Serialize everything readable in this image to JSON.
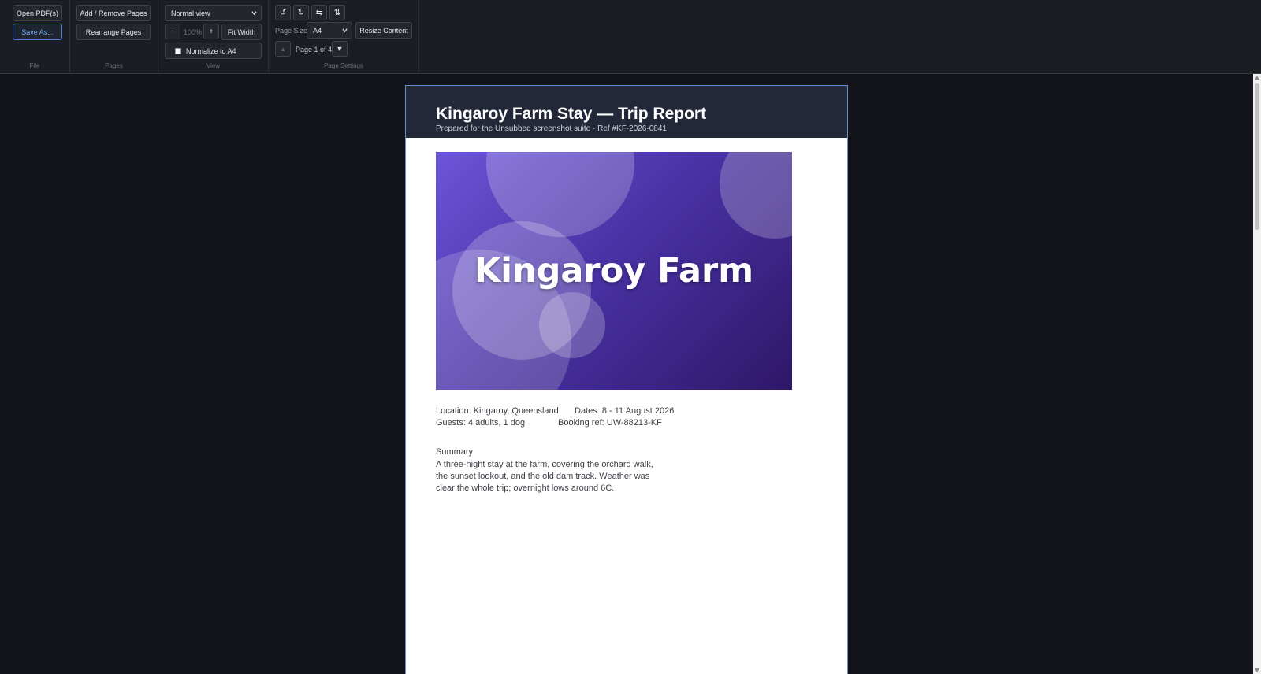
{
  "toolbar": {
    "file": {
      "caption": "File",
      "open_label": "Open PDF(s)",
      "save_label": "Save As..."
    },
    "pages": {
      "caption": "Pages",
      "add_remove_label": "Add / Remove Pages",
      "rearrange_label": "Rearrange Pages"
    },
    "view": {
      "caption": "View",
      "mode_selected": "Normal view",
      "zoom_out_label": "−",
      "zoom_value": "100%",
      "zoom_in_label": "+",
      "fit_width_label": "Fit Width",
      "normalize_label": "Normalize to A4"
    },
    "page_settings": {
      "caption": "Page Settings",
      "rotate_left_glyph": "↺",
      "rotate_right_glyph": "↻",
      "flip_h_glyph": "⇆",
      "flip_v_glyph": "⇅",
      "page_size_label": "Page Size",
      "page_size_selected": "A4",
      "resize_content_label": "Resize Content",
      "page_indicator": "Page 1 of 4",
      "prev_glyph": "▲",
      "next_glyph": "▼"
    }
  },
  "document": {
    "title": "Kingaroy Farm Stay — Trip Report",
    "subtitle": "Prepared for the Unsubbed screenshot suite · Ref #KF-2026-0841",
    "hero_text": "Kingaroy Farm",
    "location": "Location: Kingaroy, Queensland",
    "dates": "Dates: 8 - 11 August 2026",
    "guests": "Guests: 4 adults, 1 dog",
    "booking": "Booking ref: UW-88213-KF",
    "summary_heading": "Summary",
    "summary_body": "A three-night stay at the farm, covering the orchard walk, the sunset lookout, and the old dam track. Weather was clear the whole trip; overnight lows around 6C."
  },
  "colors": {
    "accent": "#4d7fd1",
    "header_bg": "#232838",
    "hero_gradient_start": "#6c55d8",
    "hero_gradient_end": "#2e1768"
  }
}
